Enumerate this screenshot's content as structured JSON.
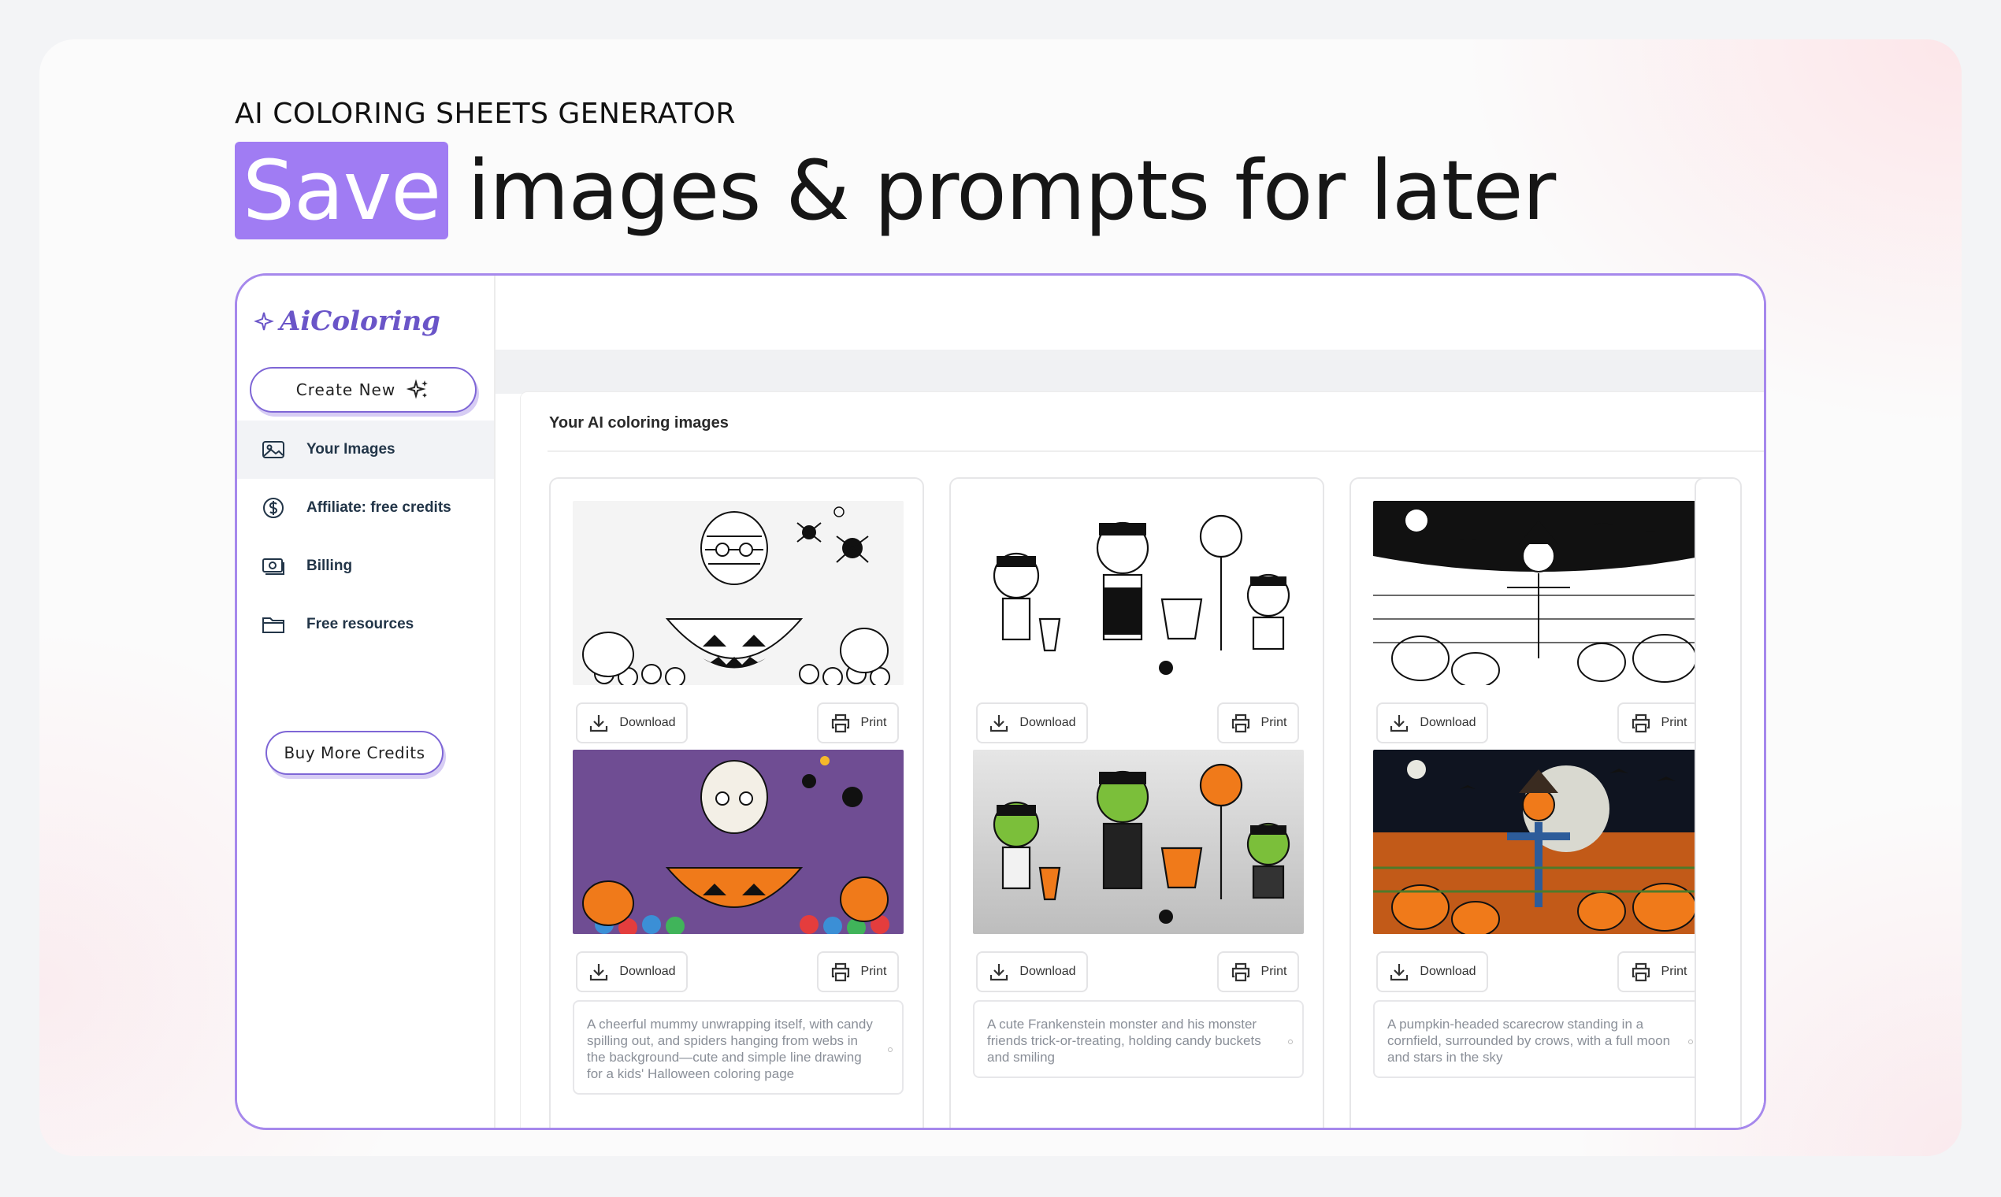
{
  "hero": {
    "eyebrow": "AI COLORING SHEETS GENERATOR",
    "highlight": "Save",
    "headline_rest": "images & prompts for later",
    "highlight_color": "#a07cf3"
  },
  "app": {
    "logo_text": "AiColoring",
    "create_button": "Create New",
    "nav": [
      {
        "label": "Your Images",
        "icon": "image-icon",
        "active": true
      },
      {
        "label": "Affiliate: free credits",
        "icon": "dollar-circle-icon",
        "active": false
      },
      {
        "label": "Billing",
        "icon": "billing-icon",
        "active": false
      },
      {
        "label": "Free resources",
        "icon": "folder-icon",
        "active": false
      }
    ],
    "buy_button": "Buy More Credits",
    "panel_title": "Your AI coloring images",
    "download_label": "Download",
    "print_label": "Print",
    "cards": [
      {
        "prompt": "A cheerful mummy unwrapping itself, with candy spilling out, and spiders hanging from webs in the background—cute and simple line drawing for a kids' Halloween coloring page"
      },
      {
        "prompt": "A cute Frankenstein monster and his monster friends trick-or-treating, holding candy buckets and smiling"
      },
      {
        "prompt": "A pumpkin-headed scarecrow standing in a cornfield, surrounded by crows, with a full moon and stars in the sky"
      }
    ],
    "accent": "#7e66d6"
  }
}
